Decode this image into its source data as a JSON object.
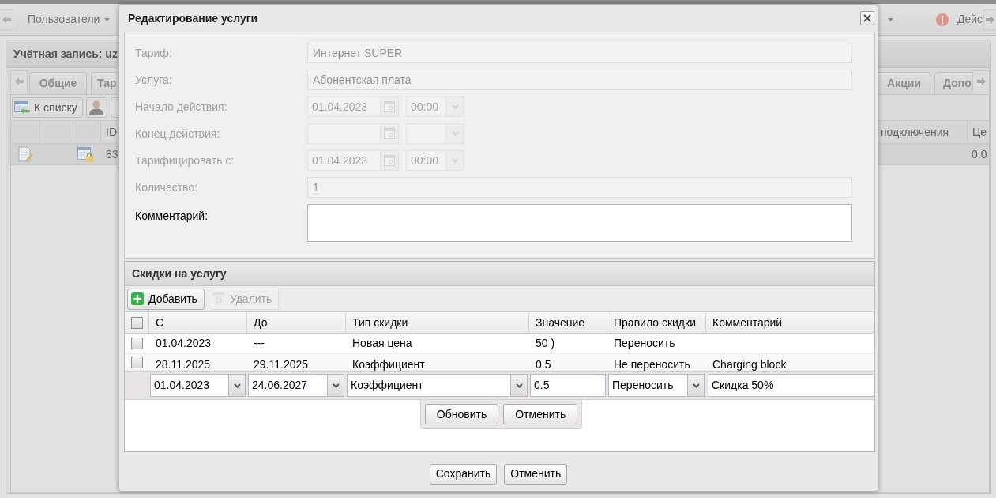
{
  "top_toolbar": {
    "menu_label": "Пользователи",
    "button_label": "Дейс"
  },
  "account_panel": {
    "title": "Учётная запись: uz",
    "tabs_left": [
      "Общие",
      "Тар"
    ],
    "tabs_right": [
      "Акции",
      "Допо"
    ],
    "back_button": "К списку",
    "grid": {
      "columns_left": [
        "ID"
      ],
      "columns_right": [
        "подключения",
        "Це"
      ],
      "row": {
        "id_column_cell": "83",
        "last_column_cell": "0.0"
      }
    }
  },
  "dialog": {
    "title": "Редактирование услуги",
    "fields": [
      {
        "kind": "text",
        "label": "Тариф:",
        "value": "Интернет SUPER",
        "disabled": true
      },
      {
        "kind": "text",
        "label": "Услуга:",
        "value": "Абонентская плата",
        "disabled": true
      },
      {
        "kind": "datetime",
        "label": "Начало действия:",
        "date": "01.04.2023",
        "time": "00:00",
        "disabled": true
      },
      {
        "kind": "datetime",
        "label": "Конец действия:",
        "disabled": true
      },
      {
        "kind": "datetime",
        "label": "Тарифицировать с:",
        "date": "01.04.2023",
        "time": "00:00",
        "disabled": true
      },
      {
        "kind": "text",
        "label": "Количество:",
        "value": "1",
        "disabled": true
      },
      {
        "kind": "textarea",
        "label": "Комментарий:",
        "disabled": false
      }
    ],
    "discounts": {
      "title": "Скидки на услугу",
      "toolbar": [
        {
          "kind": "add",
          "label": "Добавить",
          "disabled": false
        },
        {
          "kind": "delete",
          "label": "Удалить",
          "disabled": true
        }
      ],
      "select_all_checked": false,
      "columns": [
        "С",
        "До",
        "Тип скидки",
        "Значение",
        "Правило скидки",
        "Комментарий"
      ],
      "rows": [
        {
          "checked": false,
          "from": "01.04.2023",
          "to": "---",
          "type": "Новая цена",
          "value": "50 )",
          "rule": "Переносить"
        },
        {
          "checked": false,
          "from": "28.11.2025",
          "to": "29.11.2025",
          "type": "Коэффициент",
          "value": "0.5",
          "rule": "Не переносить",
          "comment": "Charging block"
        }
      ],
      "editor": {
        "fields": [
          {
            "kind": "combo",
            "value": "01.04.2023"
          },
          {
            "kind": "combo",
            "value": "24.06.2027"
          },
          {
            "kind": "combo",
            "value": "Коэффициент"
          },
          {
            "kind": "text",
            "value": "0.5"
          },
          {
            "kind": "combo",
            "value": "Переносить"
          },
          {
            "kind": "text",
            "value": "Скидка 50%"
          }
        ],
        "buttons": [
          "Обновить",
          "Отменить"
        ]
      }
    },
    "buttons": [
      "Сохранить",
      "Отменить"
    ]
  }
}
